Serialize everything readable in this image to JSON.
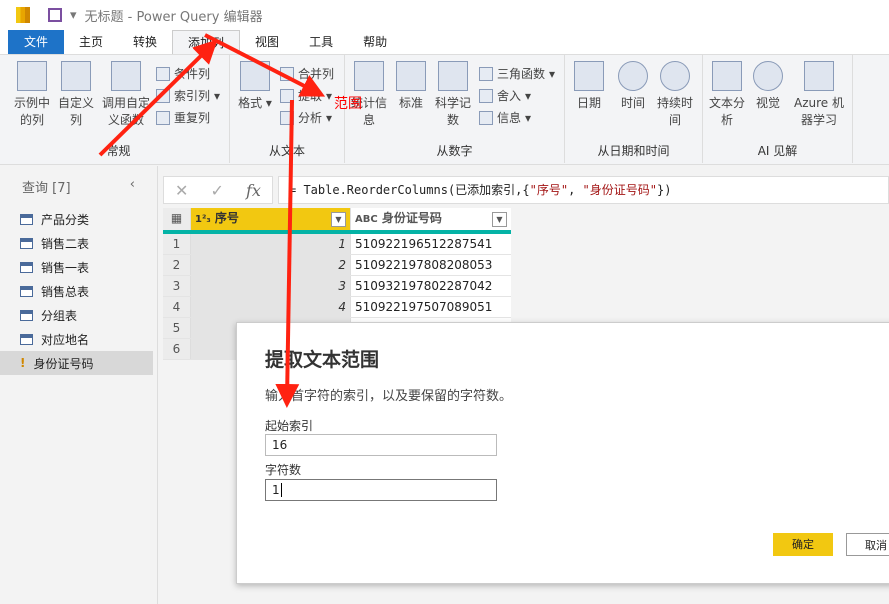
{
  "window": {
    "title": "无标题 - Power Query 编辑器"
  },
  "tabs": [
    "文件",
    "主页",
    "转换",
    "添加列",
    "视图",
    "工具",
    "帮助"
  ],
  "ribbon": {
    "general": {
      "label": "常规",
      "buttons": [
        "示例中的列",
        "自定义列",
        "调用自定义函数"
      ],
      "small": [
        "条件列",
        "索引列",
        "重复列"
      ]
    },
    "from_text": {
      "label": "从文本",
      "buttons": [
        "格式"
      ],
      "small": [
        "合并列",
        "提取",
        "分析"
      ]
    },
    "from_number": {
      "label": "从数字",
      "buttons": [
        "统计信息",
        "标准",
        "科学记数"
      ],
      "small": [
        "三角函数",
        "舍入",
        "信息"
      ]
    },
    "from_datetime": {
      "label": "从日期和时间",
      "buttons": [
        "日期",
        "时间",
        "持续时间"
      ]
    },
    "ai": {
      "label": "AI 见解",
      "buttons": [
        "文本分析",
        "视觉",
        "Azure 机器学习"
      ]
    }
  },
  "annotation": "范围",
  "queries": {
    "header": "查询 [7]",
    "items": [
      "产品分类",
      "销售二表",
      "销售一表",
      "销售总表",
      "分组表",
      "对应地名",
      "身份证号码"
    ]
  },
  "formula": {
    "prefix": "= Table.ReorderColumns(已添加索引,{",
    "s1": "\"序号\"",
    "sep": ", ",
    "s2": "\"身份证号码\"",
    "suffix": "})"
  },
  "grid": {
    "columns": [
      "序号",
      "身份证号码"
    ],
    "rows": [
      {
        "n": "1",
        "idx": "1",
        "id": "510922196512287541"
      },
      {
        "n": "2",
        "idx": "2",
        "id": "510922197808208053"
      },
      {
        "n": "3",
        "idx": "3",
        "id": "510932197802287042"
      },
      {
        "n": "4",
        "idx": "4",
        "id": "510922197507089051"
      },
      {
        "n": "5",
        "idx": "",
        "id": ""
      },
      {
        "n": "6",
        "idx": "",
        "id": ""
      }
    ]
  },
  "dialog": {
    "title": "提取文本范围",
    "description": "输入首字符的索引，以及要保留的字符数。",
    "start_label": "起始索引",
    "start_value": "16",
    "count_label": "字符数",
    "count_value": "1",
    "ok": "确定",
    "cancel": "取消"
  }
}
